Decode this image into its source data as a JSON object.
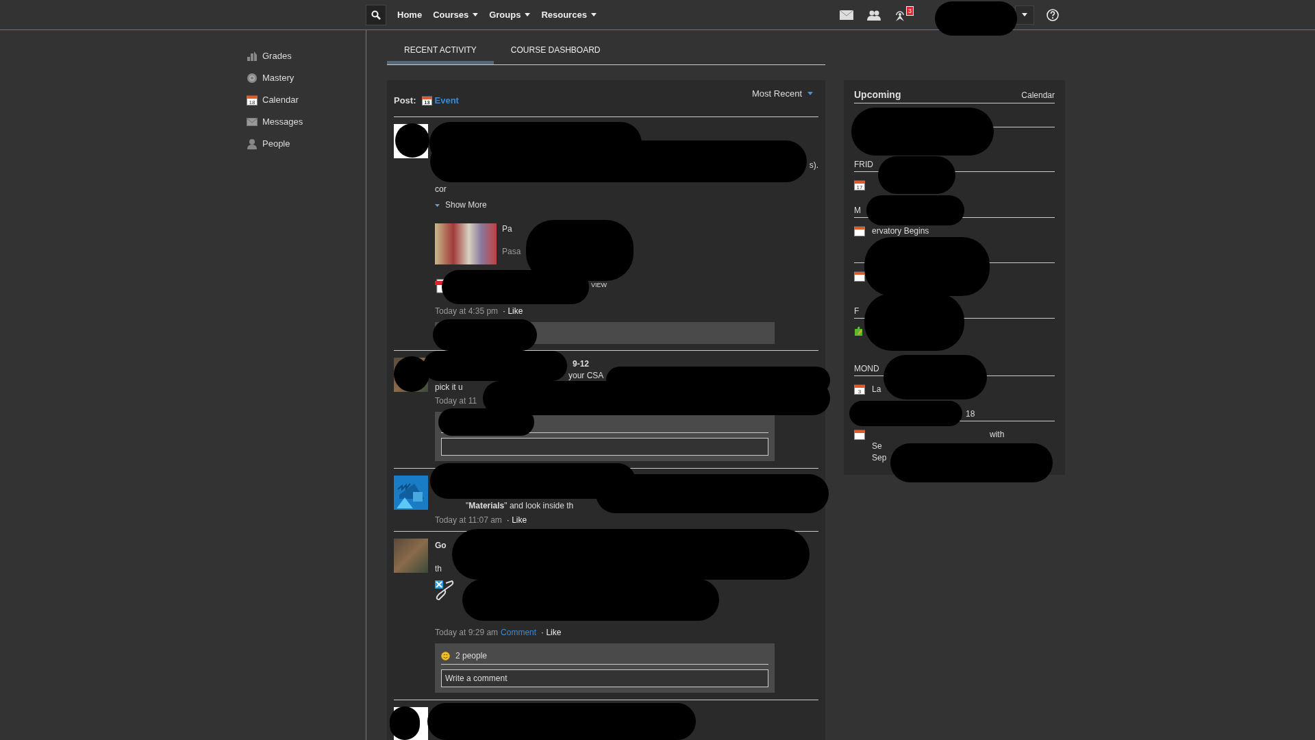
{
  "nav": {
    "items": [
      {
        "label": "Home",
        "dropdown": false
      },
      {
        "label": "Courses",
        "dropdown": true
      },
      {
        "label": "Groups",
        "dropdown": true
      },
      {
        "label": "Resources",
        "dropdown": true
      }
    ],
    "notification_count": "3"
  },
  "sidebar": {
    "items": [
      {
        "label": "Grades",
        "kind": "grades"
      },
      {
        "label": "Mastery",
        "kind": "mastery"
      },
      {
        "label": "Calendar",
        "kind": "calendar",
        "icon_text": "18"
      },
      {
        "label": "Messages",
        "kind": "mail"
      },
      {
        "label": "People",
        "kind": "person"
      }
    ]
  },
  "tabs": [
    {
      "label": "RECENT ACTIVITY",
      "selected": true
    },
    {
      "label": "COURSE DASHBOARD",
      "selected": false
    }
  ],
  "composer": {
    "label": "Post:",
    "option": "Event",
    "option_icon_text": "13",
    "sort": "Most Recent"
  },
  "posts": [
    {
      "kind": "blank",
      "blocks": [
        {
          "kind": "text",
          "text": "s)."
        },
        {
          "kind": "text",
          "text": "cor"
        },
        {
          "kind": "show_more",
          "label": "Show More"
        },
        {
          "kind": "link_card",
          "lines": [
            "Pa",
            "Pasa"
          ]
        },
        {
          "kind": "file",
          "label": "VIEW"
        },
        {
          "kind": "meta",
          "time": "Today at 4:35 pm",
          "actions": [
            {
              "label": "· Like",
              "link": false
            }
          ]
        },
        {
          "kind": "comment_bar"
        }
      ]
    },
    {
      "kind": "photo",
      "blocks": [
        {
          "kind": "text",
          "text": "9-12",
          "bold": true
        },
        {
          "kind": "text",
          "text": "your CSA"
        },
        {
          "kind": "text",
          "text": "pick it u"
        },
        {
          "kind": "meta",
          "time": "Today at 11"
        },
        {
          "kind": "comment_box"
        }
      ]
    },
    {
      "kind": "art",
      "blocks": [
        {
          "kind": "text",
          "text": "\"**Materials**\" and look inside th"
        },
        {
          "kind": "meta",
          "time": "Today at 11:07 am",
          "actions": [
            {
              "label": "· Like",
              "link": false
            }
          ]
        }
      ]
    },
    {
      "kind": "photo",
      "blocks": [
        {
          "kind": "text",
          "text": "Go",
          "bold": true
        },
        {
          "kind": "text",
          "text": "th"
        },
        {
          "kind": "link_icon"
        },
        {
          "kind": "meta",
          "time": "Today at 9:29 am",
          "actions": [
            {
              "label": "Comment",
              "link": true
            },
            {
              "label": "· Like",
              "link": false
            }
          ]
        },
        {
          "kind": "comment_box",
          "reaction": "2 people",
          "placeholder": "Write a comment"
        }
      ]
    },
    {
      "kind": "blank"
    }
  ],
  "upcoming": {
    "title": "Upcoming",
    "link": "Calendar",
    "groups": [
      {
        "kind": "hidden"
      },
      {
        "kind": "day",
        "day": "FRID",
        "events": [
          {
            "kind": "calendar",
            "icon_text": "17"
          }
        ]
      },
      {
        "kind": "day",
        "day": "M",
        "events": [
          {
            "kind": "calendar",
            "lines": [
              "ervatory Begins"
            ]
          }
        ]
      },
      {
        "kind": "day",
        "events": [
          {
            "kind": "calendar"
          }
        ]
      },
      {
        "kind": "day",
        "day": "F",
        "events": [
          {
            "kind": "puzzle"
          }
        ]
      },
      {
        "kind": "day",
        "day": "MOND",
        "events": [
          {
            "kind": "calendar",
            "icon_text": "3",
            "lines": [
              "La"
            ]
          }
        ]
      },
      {
        "kind": "day",
        "day": "18",
        "events": [
          {
            "kind": "calendar",
            "lines": [
              "with",
              "Se",
              "Sep"
            ]
          }
        ]
      }
    ]
  }
}
